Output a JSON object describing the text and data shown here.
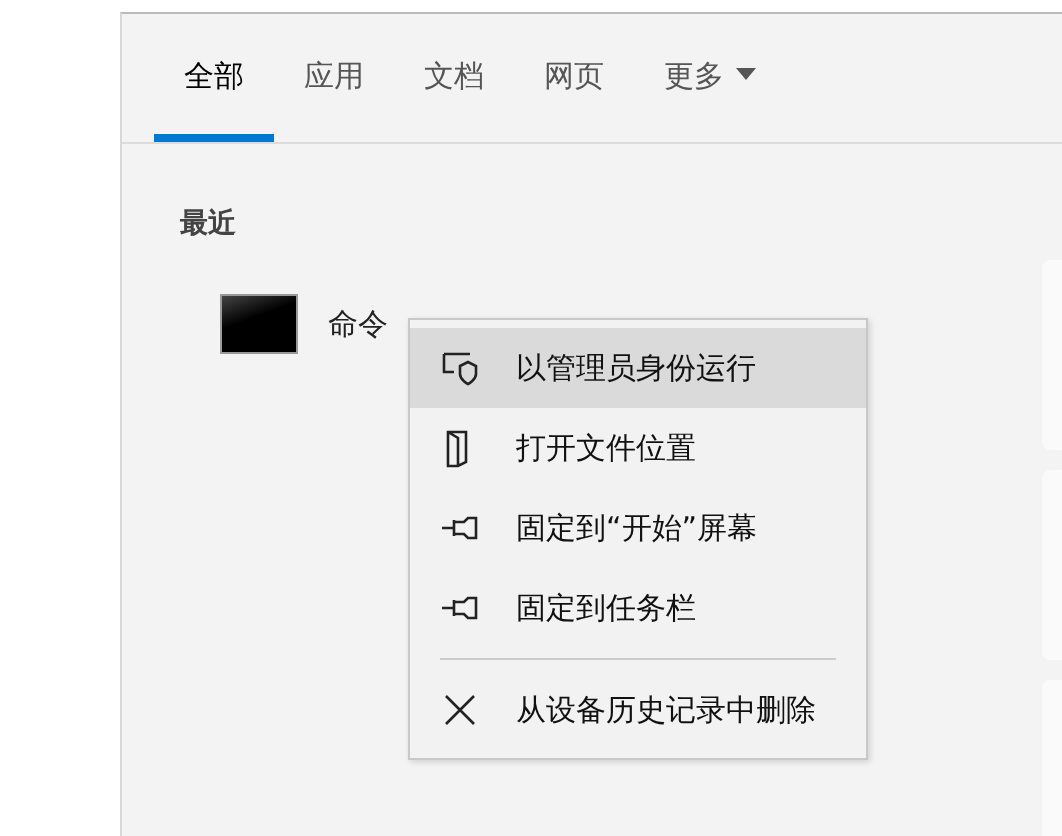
{
  "tabs": [
    {
      "label": "全部",
      "selected": true
    },
    {
      "label": "应用",
      "selected": false
    },
    {
      "label": "文档",
      "selected": false
    },
    {
      "label": "网页",
      "selected": false
    },
    {
      "label": "更多",
      "selected": false,
      "dropdown": true
    }
  ],
  "recent": {
    "heading": "最近",
    "items": [
      {
        "label": "命令"
      }
    ]
  },
  "context_menu": [
    {
      "kind": "shield",
      "label": "以管理员身份运行",
      "selected": true
    },
    {
      "kind": "folder",
      "label": "打开文件位置",
      "selected": false
    },
    {
      "kind": "pin",
      "label": "固定到“开始”屏幕",
      "selected": false
    },
    {
      "kind": "pin",
      "label": "固定到任务栏",
      "selected": false
    },
    {
      "kind": "separator"
    },
    {
      "kind": "remove",
      "label": "从设备历史记录中删除",
      "selected": false
    }
  ]
}
